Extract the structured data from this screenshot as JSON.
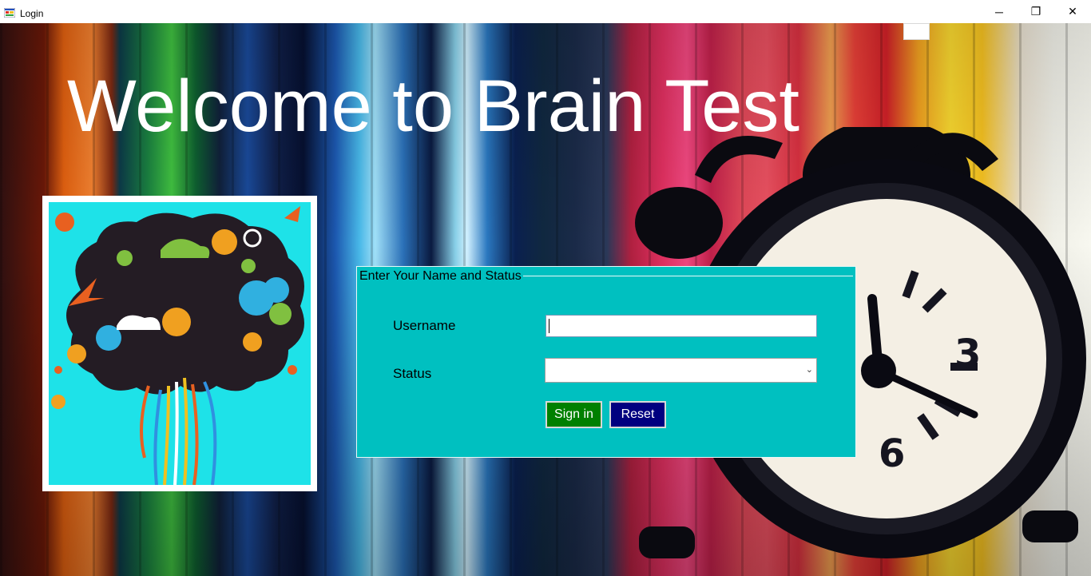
{
  "window": {
    "title": "Login",
    "controls": {
      "minimize": "─",
      "maximize": "❐",
      "close": "✕"
    }
  },
  "welcome": {
    "heading": "Welcome to Brain Test"
  },
  "login_group": {
    "legend": "Enter Your Name and Status",
    "username_label": "Username",
    "username_value": "",
    "status_label": "Status",
    "status_selected": "",
    "signin_label": "Sign in",
    "reset_label": "Reset"
  },
  "colors": {
    "group_background": "#00c0c0",
    "signin_button": "#008000",
    "reset_button": "#000080",
    "brain_background": "#1ee2e8"
  }
}
